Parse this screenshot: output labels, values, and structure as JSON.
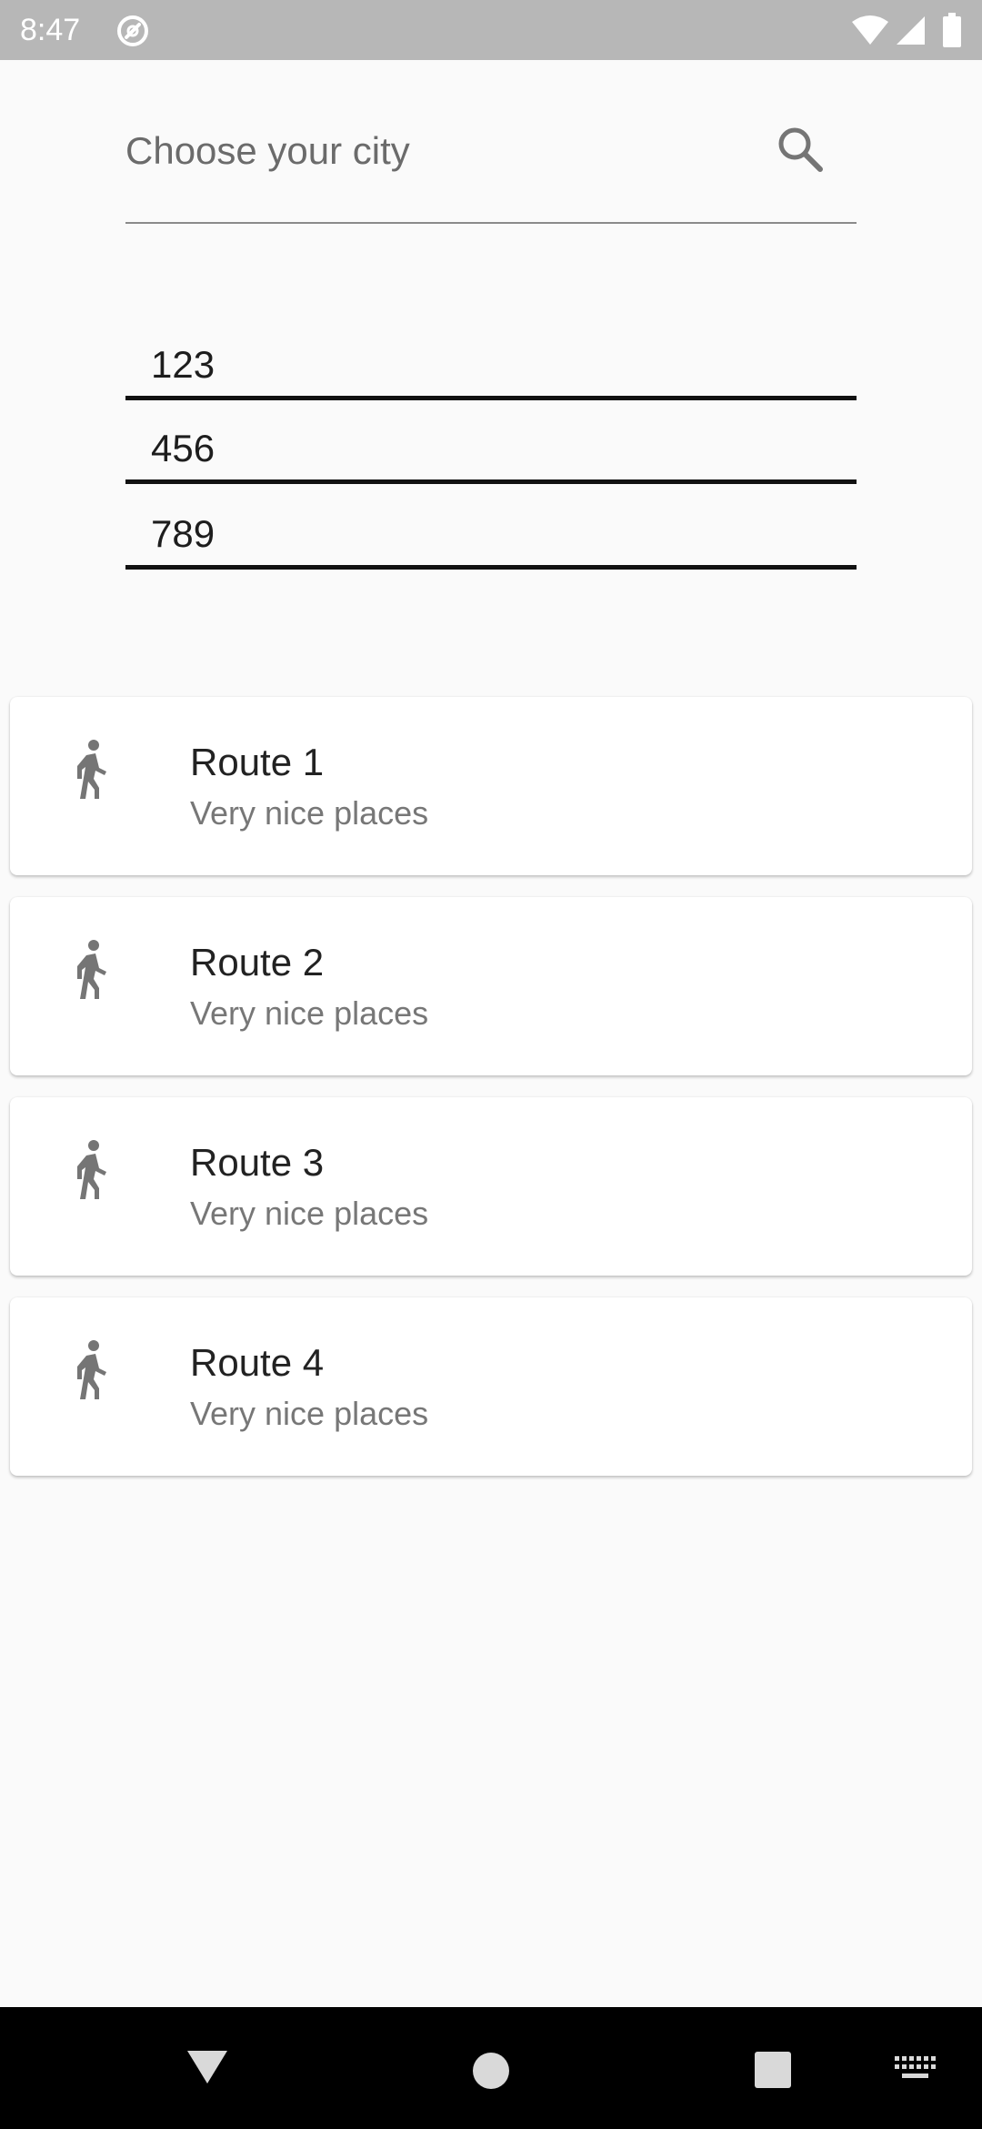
{
  "status_bar": {
    "time": "8:47",
    "icons": [
      "app-notification-icon",
      "wifi-icon",
      "signal-icon",
      "battery-icon"
    ]
  },
  "search": {
    "placeholder": "Choose your city",
    "icon": "search-icon"
  },
  "number_fields": [
    {
      "value": "123"
    },
    {
      "value": "456"
    },
    {
      "value": "789"
    }
  ],
  "routes": [
    {
      "title": "Route 1",
      "subtitle": "Very nice places",
      "icon": "walking-icon"
    },
    {
      "title": "Route 2",
      "subtitle": "Very nice places",
      "icon": "walking-icon"
    },
    {
      "title": "Route 3",
      "subtitle": "Very nice places",
      "icon": "walking-icon"
    },
    {
      "title": "Route 4",
      "subtitle": "Very nice places",
      "icon": "walking-icon"
    }
  ],
  "nav_bar": {
    "icons": [
      "back-icon",
      "home-icon",
      "recents-icon",
      "keyboard-icon"
    ]
  },
  "colors": {
    "status_bar": "#b7b7b7",
    "background": "#fafafa",
    "card": "#ffffff",
    "icon_gray": "#757575",
    "nav_bar": "#000000"
  }
}
